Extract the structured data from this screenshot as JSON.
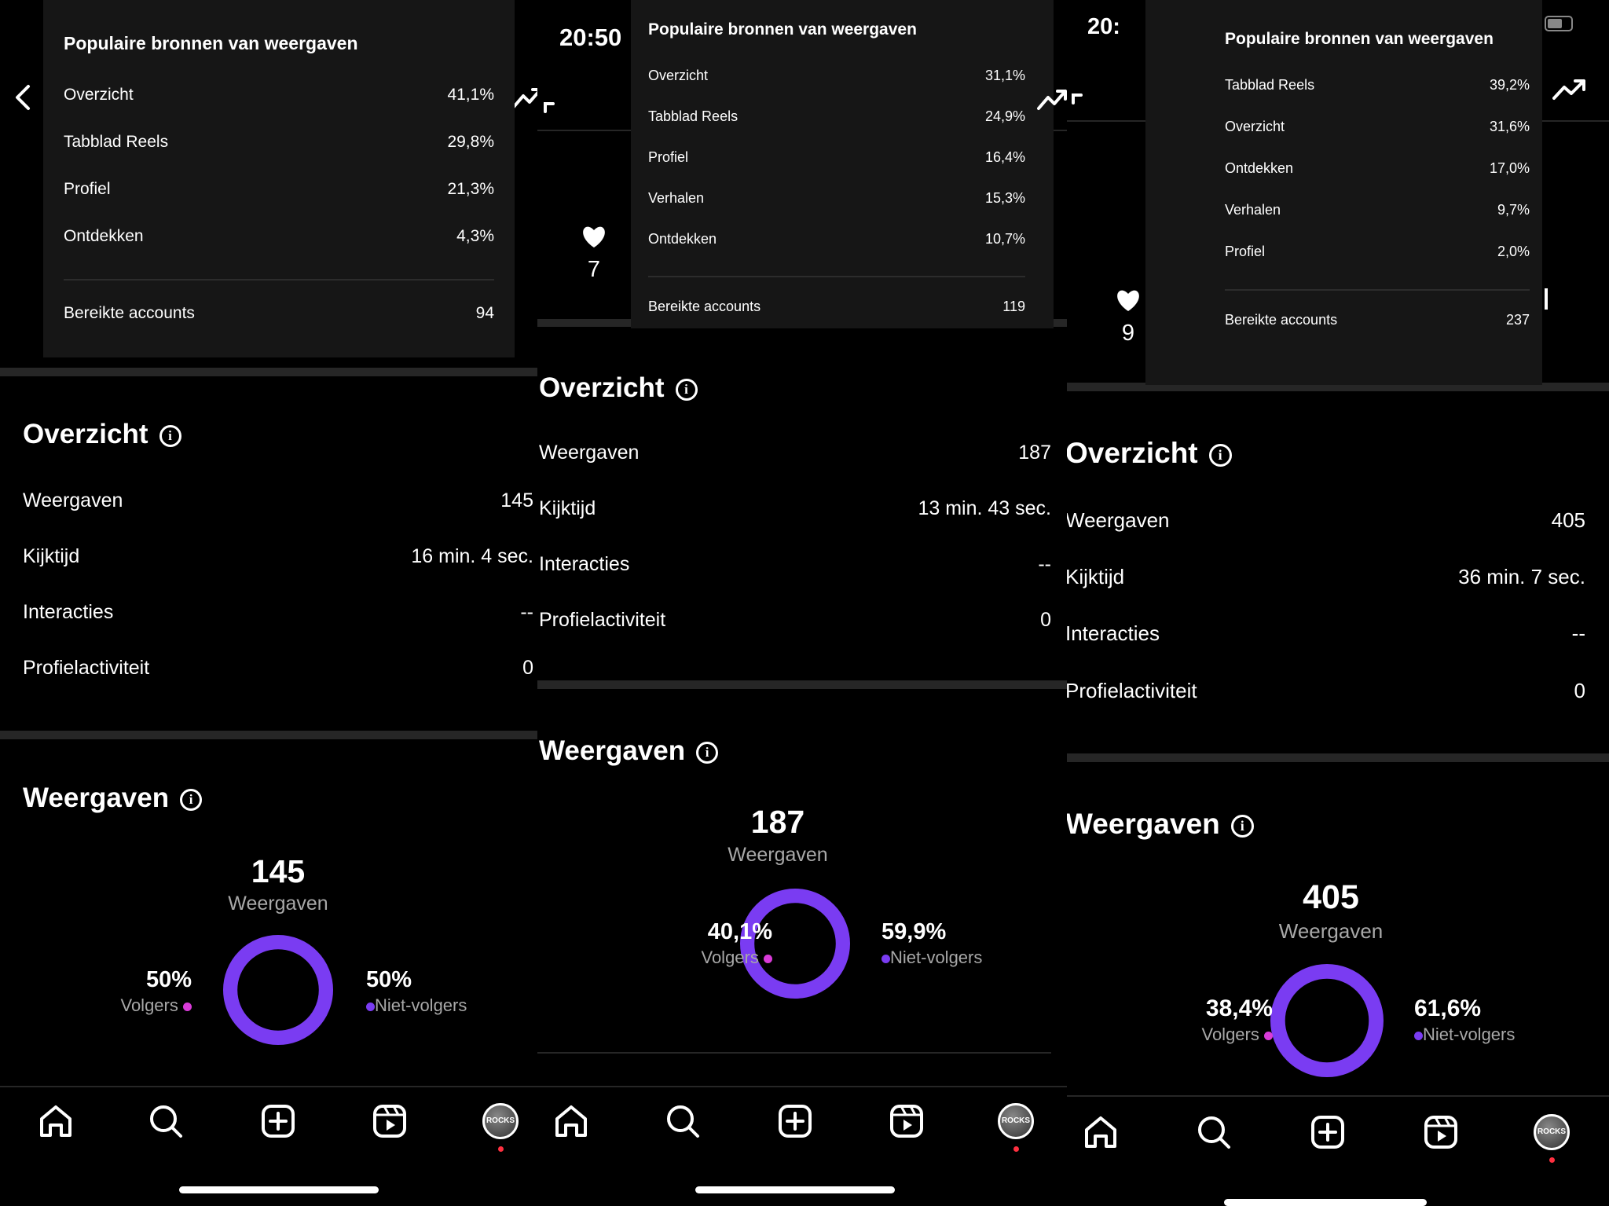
{
  "colors": {
    "followers": "#d93bd9",
    "non_followers": "#7a3cf2",
    "track": "#000000"
  },
  "tooltip_title": "Populaire bronnen van weergaven",
  "nav_icons": [
    "home-icon",
    "search-icon",
    "create-icon",
    "reels-icon",
    "profile-avatar"
  ],
  "avatar_text": "ROCKS",
  "panels": [
    {
      "time": "",
      "tooltip": {
        "rows": [
          {
            "label": "Overzicht",
            "value": "41,1%"
          },
          {
            "label": "Tabblad Reels",
            "value": "29,8%"
          },
          {
            "label": "Profiel",
            "value": "21,3%"
          },
          {
            "label": "Ontdekken",
            "value": "4,3%"
          }
        ],
        "reached_label": "Bereikte accounts",
        "reached_value": "94"
      },
      "likes": "",
      "overview": {
        "title": "Overzicht",
        "rows": [
          {
            "label": "Weergaven",
            "value": "145"
          },
          {
            "label": "Kijktijd",
            "value": "16 min. 4 sec."
          },
          {
            "label": "Interacties",
            "value": "--"
          },
          {
            "label": "Profielactiviteit",
            "value": "0"
          }
        ]
      },
      "views": {
        "title": "Weergaven",
        "total": "145",
        "total_label": "Weergaven",
        "followers_pct": "50%",
        "followers_label": "Volgers",
        "followers_fraction": 0.5,
        "non_followers_pct": "50%",
        "non_followers_label": "Niet-volgers"
      }
    },
    {
      "time": "20:50",
      "tooltip": {
        "rows": [
          {
            "label": "Overzicht",
            "value": "31,1%"
          },
          {
            "label": "Tabblad Reels",
            "value": "24,9%"
          },
          {
            "label": "Profiel",
            "value": "16,4%"
          },
          {
            "label": "Verhalen",
            "value": "15,3%"
          },
          {
            "label": "Ontdekken",
            "value": "10,7%"
          }
        ],
        "reached_label": "Bereikte accounts",
        "reached_value": "119"
      },
      "likes": "7",
      "overview": {
        "title": "Overzicht",
        "rows": [
          {
            "label": "Weergaven",
            "value": "187"
          },
          {
            "label": "Kijktijd",
            "value": "13 min. 43 sec."
          },
          {
            "label": "Interacties",
            "value": "--"
          },
          {
            "label": "Profielactiviteit",
            "value": "0"
          }
        ]
      },
      "views": {
        "title": "Weergaven",
        "total": "187",
        "total_label": "Weergaven",
        "followers_pct": "40,1%",
        "followers_label": "Volgers",
        "followers_fraction": 0.401,
        "non_followers_pct": "59,9%",
        "non_followers_label": "Niet-volgers"
      }
    },
    {
      "time": "20:",
      "tooltip": {
        "rows": [
          {
            "label": "Tabblad Reels",
            "value": "39,2%"
          },
          {
            "label": "Overzicht",
            "value": "31,6%"
          },
          {
            "label": "Ontdekken",
            "value": "17,0%"
          },
          {
            "label": "Verhalen",
            "value": "9,7%"
          },
          {
            "label": "Profiel",
            "value": "2,0%"
          }
        ],
        "reached_label": "Bereikte accounts",
        "reached_value": "237"
      },
      "likes": "9",
      "overview": {
        "title": "Overzicht",
        "rows": [
          {
            "label": "Weergaven",
            "value": "405"
          },
          {
            "label": "Kijktijd",
            "value": "36 min. 7 sec."
          },
          {
            "label": "Interacties",
            "value": "--"
          },
          {
            "label": "Profielactiviteit",
            "value": "0"
          }
        ]
      },
      "views": {
        "title": "Weergaven",
        "total": "405",
        "total_label": "Weergaven",
        "followers_pct": "38,4%",
        "followers_label": "Volgers",
        "followers_fraction": 0.384,
        "non_followers_pct": "61,6%",
        "non_followers_label": "Niet-volgers"
      }
    }
  ]
}
